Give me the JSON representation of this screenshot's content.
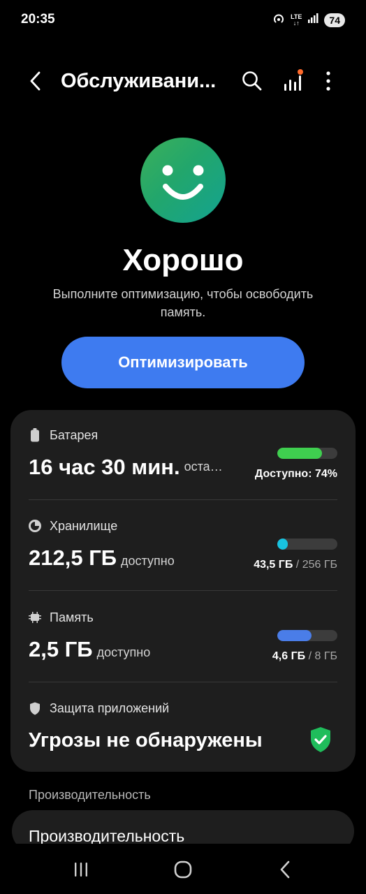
{
  "status_bar": {
    "time": "20:35",
    "network": "LTE",
    "battery_level": "74",
    "icons": [
      "hotspot-icon",
      "lte-icon",
      "signal-icon",
      "battery-icon"
    ]
  },
  "app_bar": {
    "title": "Обслуживани...",
    "back_icon": "chevron-left-icon",
    "search_icon": "search-icon",
    "stats_icon": "stats-icon",
    "more_icon": "more-vert-icon"
  },
  "status": {
    "icon": "smiley-face-icon",
    "title": "Хорошо",
    "description": "Выполните оптимизацию, чтобы освободить память."
  },
  "optimize_button": {
    "label": "Оптимизировать"
  },
  "battery": {
    "label": "Батарея",
    "value": "16 час 30 мин.",
    "suffix": "осталось",
    "available_text": "Доступно: 74%",
    "percent": 74,
    "color": "#3fcf4f"
  },
  "storage": {
    "label": "Хранилище",
    "value": "212,5 ГБ",
    "suffix": "доступно",
    "used": "43,5 ГБ",
    "total": "/ 256 ГБ",
    "percent": 17,
    "color": "#18c3e0"
  },
  "memory": {
    "label": "Память",
    "value": "2,5 ГБ",
    "suffix": "доступно",
    "used": "4,6 ГБ",
    "total": "/ 8 ГБ",
    "percent": 57,
    "color": "#4a7de8"
  },
  "app_protection": {
    "label": "Защита приложений",
    "value": "Угрозы не обнаружены",
    "status_color": "#1fbd5b"
  },
  "performance": {
    "header": "Производительность",
    "item_label": "Производительность"
  },
  "colors": {
    "accent": "#3e7bf0",
    "card": "#1e1e1e",
    "notification_dot": "#ff6a2b"
  }
}
